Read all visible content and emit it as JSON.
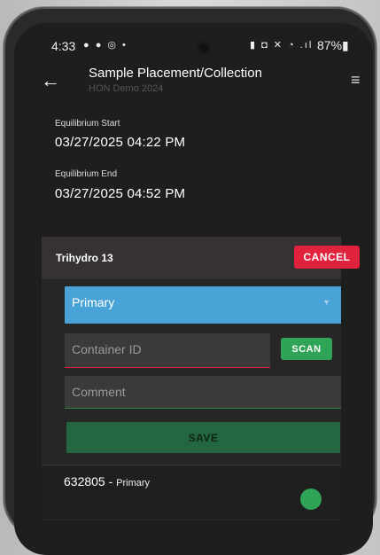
{
  "status_bar": {
    "time": "4:33",
    "left_icons": "● ● ◎ •",
    "right_icons": "▮ ◘ ✕ ◔ .ıl",
    "battery": "87%▮"
  },
  "app_bar": {
    "title": "Sample Placement/Collection",
    "subtitle": "HON Demo 2024",
    "back_icon": "←",
    "menu_icon": "≡"
  },
  "equilibrium": {
    "start_label": "Equilibrium Start",
    "start_value": "03/27/2025 04:22 PM",
    "end_label": "Equilibrium End",
    "end_value": "03/27/2025 04:52 PM"
  },
  "card": {
    "title": "Trihydro 13",
    "cancel_label": "CANCEL",
    "select": {
      "value": "Primary",
      "icon": "▼"
    },
    "container_input": {
      "placeholder": "Container ID",
      "value": ""
    },
    "scan_label": "SCAN",
    "comment_input": {
      "placeholder": "Comment",
      "value": ""
    },
    "save_label": "SAVE"
  },
  "list": {
    "items": [
      {
        "id": "632805",
        "separator": " - ",
        "type": "Primary"
      }
    ]
  },
  "colors": {
    "accent_blue": "#49a3d7",
    "cancel_red": "#e0223d",
    "scan_green": "#2fa356",
    "save_green": "#24663f"
  }
}
